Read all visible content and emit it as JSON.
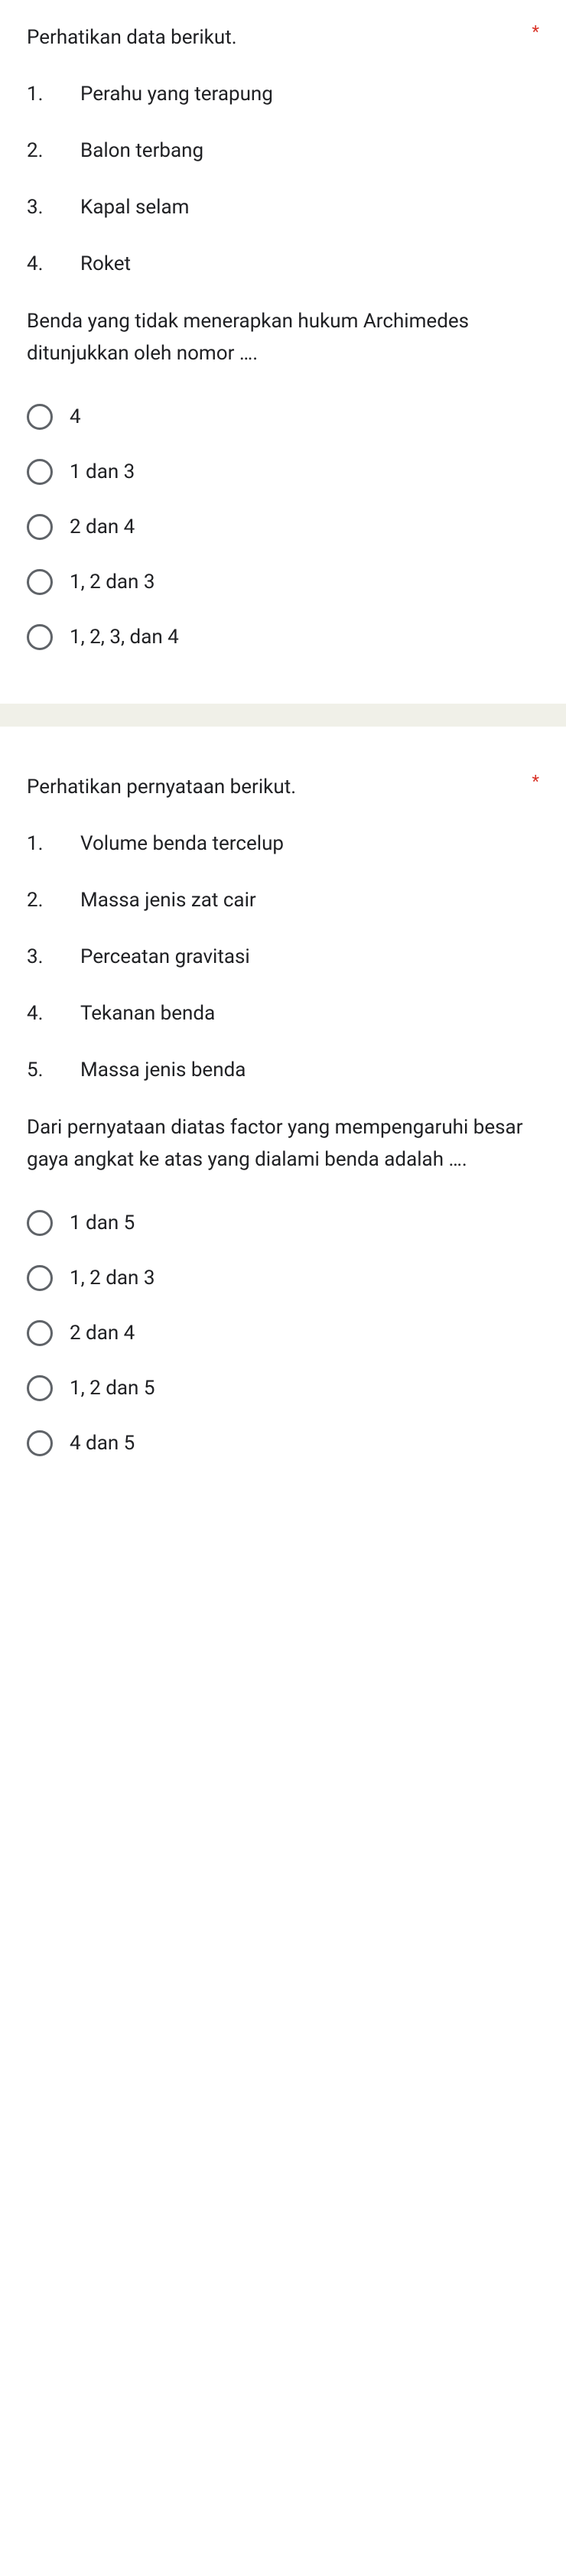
{
  "questions": [
    {
      "intro": "Perhatikan data berikut.",
      "required": "*",
      "items": [
        {
          "num": "1.",
          "text": "Perahu yang terapung"
        },
        {
          "num": "2.",
          "text": "Balon terbang"
        },
        {
          "num": "3.",
          "text": "Kapal selam"
        },
        {
          "num": "4.",
          "text": "Roket"
        }
      ],
      "prompt": "Benda yang tidak menerapkan hukum Archimedes ditunjukkan oleh nomor ….",
      "options": [
        "4",
        "1 dan 3",
        "2 dan 4",
        "1, 2 dan 3",
        "1, 2, 3, dan 4"
      ]
    },
    {
      "intro": "Perhatikan pernyataan berikut.",
      "required": "*",
      "items": [
        {
          "num": "1.",
          "text": "Volume benda tercelup"
        },
        {
          "num": "2.",
          "text": "Massa jenis zat cair"
        },
        {
          "num": "3.",
          "text": "Perceatan gravitasi"
        },
        {
          "num": "4.",
          "text": "Tekanan benda"
        },
        {
          "num": "5.",
          "text": "Massa jenis benda"
        }
      ],
      "prompt": "Dari pernyataan diatas factor yang mempengaruhi besar gaya angkat ke atas yang dialami benda adalah ….",
      "options": [
        "1 dan 5",
        "1, 2 dan 3",
        "2 dan 4",
        "1, 2 dan 5",
        "4 dan 5"
      ]
    }
  ]
}
